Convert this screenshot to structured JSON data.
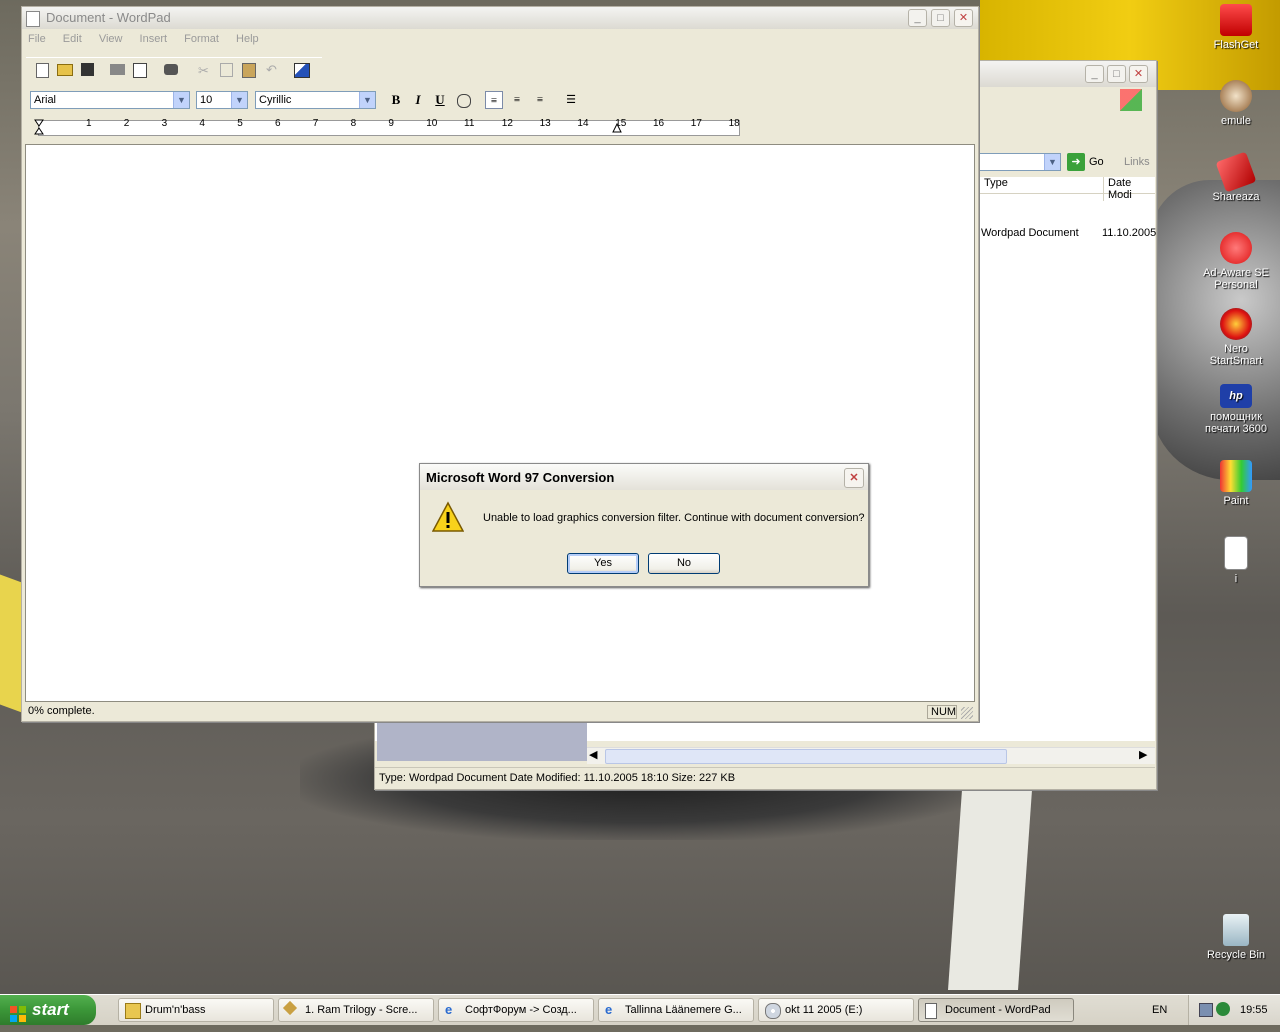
{
  "desktop": {
    "icons": [
      {
        "label": "FlashGet"
      },
      {
        "label": "emule"
      },
      {
        "label": "Shareaza"
      },
      {
        "label": "Ad-Aware SE Personal"
      },
      {
        "label": "Nero StartSmart"
      },
      {
        "label": "помощник печати 3600"
      },
      {
        "label": "Paint"
      },
      {
        "label": "i"
      },
      {
        "label": "Recycle Bin"
      }
    ]
  },
  "explorer": {
    "go_label": "Go",
    "links_label": "Links",
    "columns": [
      "Type",
      "Date Modi"
    ],
    "row": {
      "type": "Wordpad Document",
      "date": "11.10.2005"
    },
    "status": "Type: Wordpad Document Date Modified: 11.10.2005 18:10 Size: 227 KB"
  },
  "wordpad": {
    "title": "Document - WordPad",
    "menu": [
      "File",
      "Edit",
      "View",
      "Insert",
      "Format",
      "Help"
    ],
    "font": "Arial",
    "size": "10",
    "script": "Cyrillic",
    "bold": "B",
    "italic": "I",
    "underline": "U",
    "ruler": [
      "1",
      "2",
      "3",
      "4",
      "5",
      "6",
      "7",
      "8",
      "9",
      "10",
      "11",
      "12",
      "13",
      "14",
      "15",
      "16",
      "17",
      "18"
    ],
    "status_text": "0% complete.",
    "num": "NUM"
  },
  "dialog": {
    "title": "Microsoft Word 97 Conversion",
    "message": "Unable to load graphics conversion filter. Continue with document conversion?",
    "yes": "Yes",
    "no": "No"
  },
  "taskbar": {
    "start": "start",
    "tasks": [
      {
        "label": "Drum'n'bass"
      },
      {
        "label": "1. Ram Trilogy - Scre..."
      },
      {
        "label": "СофтФорум -> Созд..."
      },
      {
        "label": "Tallinna Läänemere G..."
      },
      {
        "label": "okt 11 2005 (E:)"
      },
      {
        "label": "Document - WordPad"
      }
    ],
    "lang": "EN",
    "clock": "19:55"
  }
}
